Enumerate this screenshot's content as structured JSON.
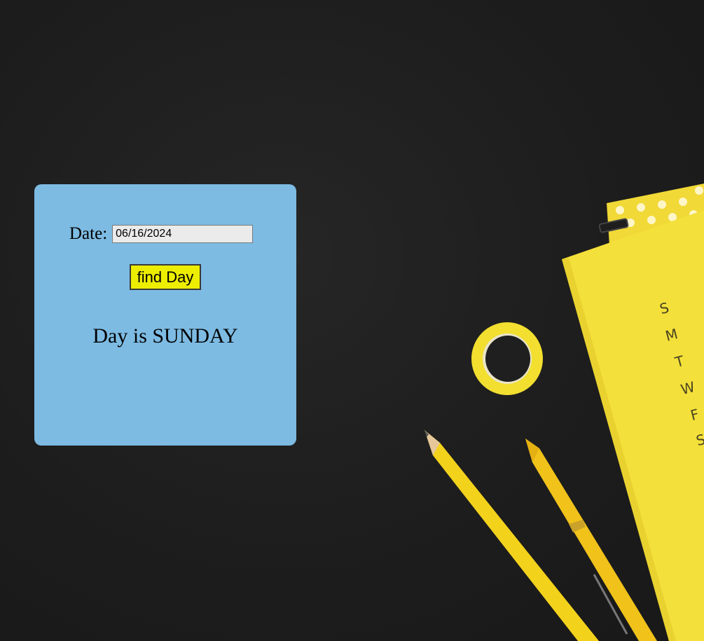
{
  "form": {
    "date_label": "Date:",
    "date_value": "06/16/2024",
    "button_label": "find Day",
    "result_text": "Day is SUNDAY"
  },
  "background": {
    "calendar_letters": [
      "S",
      "M",
      "T",
      "W",
      "F",
      "S"
    ],
    "colors": {
      "backdrop": "#1c1c1c",
      "card": "#7dbbe3",
      "button": "#eded00",
      "accent_yellow": "#f2e13a"
    }
  }
}
